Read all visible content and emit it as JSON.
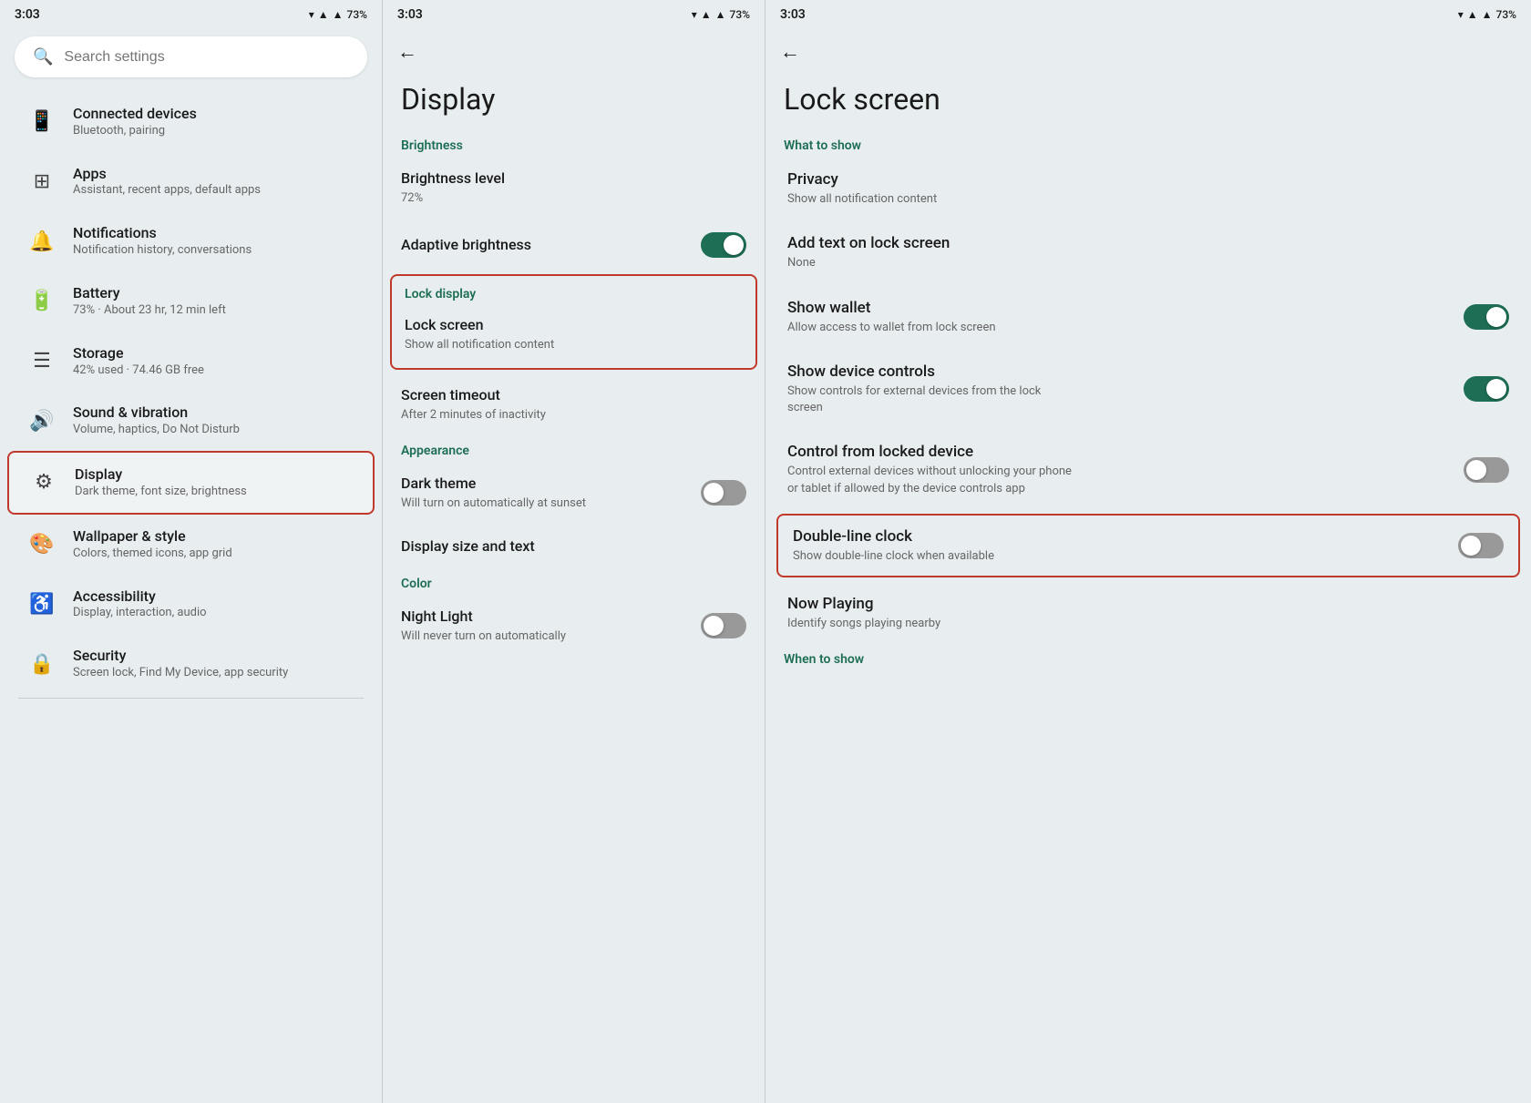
{
  "statusBar": {
    "time": "3:03",
    "battery": "73%"
  },
  "panel1": {
    "search": {
      "placeholder": "Search settings"
    },
    "items": [
      {
        "id": "connected-devices",
        "icon": "📱",
        "title": "Connected devices",
        "subtitle": "Bluetooth, pairing",
        "selected": false
      },
      {
        "id": "apps",
        "icon": "⊞",
        "title": "Apps",
        "subtitle": "Assistant, recent apps, default apps",
        "selected": false
      },
      {
        "id": "notifications",
        "icon": "🔔",
        "title": "Notifications",
        "subtitle": "Notification history, conversations",
        "selected": false
      },
      {
        "id": "battery",
        "icon": "🔋",
        "title": "Battery",
        "subtitle": "73% · About 23 hr, 12 min left",
        "selected": false
      },
      {
        "id": "storage",
        "icon": "☰",
        "title": "Storage",
        "subtitle": "42% used · 74.46 GB free",
        "selected": false
      },
      {
        "id": "sound-vibration",
        "icon": "🔊",
        "title": "Sound & vibration",
        "subtitle": "Volume, haptics, Do Not Disturb",
        "selected": false
      },
      {
        "id": "display",
        "icon": "⚙",
        "title": "Display",
        "subtitle": "Dark theme, font size, brightness",
        "selected": true
      },
      {
        "id": "wallpaper",
        "icon": "🎨",
        "title": "Wallpaper & style",
        "subtitle": "Colors, themed icons, app grid",
        "selected": false
      },
      {
        "id": "accessibility",
        "icon": "♿",
        "title": "Accessibility",
        "subtitle": "Display, interaction, audio",
        "selected": false
      },
      {
        "id": "security",
        "icon": "🔒",
        "title": "Security",
        "subtitle": "Screen lock, Find My Device, app security",
        "selected": false
      }
    ]
  },
  "panel2": {
    "backLabel": "←",
    "title": "Display",
    "sections": [
      {
        "label": "Brightness",
        "items": [
          {
            "id": "brightness-level",
            "title": "Brightness level",
            "subtitle": "72%",
            "hasToggle": false,
            "highlighted": false
          },
          {
            "id": "adaptive-brightness",
            "title": "Adaptive brightness",
            "subtitle": "",
            "hasToggle": true,
            "toggleOn": true,
            "highlighted": false
          }
        ]
      },
      {
        "label": "Lock display",
        "isHighlighted": true,
        "items": [
          {
            "id": "lock-screen",
            "title": "Lock screen",
            "subtitle": "Show all notification content",
            "hasToggle": false,
            "highlighted": true
          }
        ]
      },
      {
        "label": "",
        "items": [
          {
            "id": "screen-timeout",
            "title": "Screen timeout",
            "subtitle": "After 2 minutes of inactivity",
            "hasToggle": false,
            "highlighted": false
          }
        ]
      },
      {
        "label": "Appearance",
        "items": [
          {
            "id": "dark-theme",
            "title": "Dark theme",
            "subtitle": "Will turn on automatically at sunset",
            "hasToggle": true,
            "toggleOn": false,
            "highlighted": false
          },
          {
            "id": "display-size-text",
            "title": "Display size and text",
            "subtitle": "",
            "hasToggle": false,
            "highlighted": false
          }
        ]
      },
      {
        "label": "Color",
        "items": [
          {
            "id": "night-light",
            "title": "Night Light",
            "subtitle": "Will never turn on automatically",
            "hasToggle": true,
            "toggleOn": false,
            "highlighted": false
          }
        ]
      }
    ]
  },
  "panel3": {
    "backLabel": "←",
    "title": "Lock screen",
    "whatToShowLabel": "What to show",
    "whenToShowLabel": "When to show",
    "items": [
      {
        "id": "privacy",
        "title": "Privacy",
        "subtitle": "Show all notification content",
        "hasToggle": false,
        "highlighted": false
      },
      {
        "id": "add-text-lock-screen",
        "title": "Add text on lock screen",
        "subtitle": "None",
        "hasToggle": false,
        "highlighted": false
      },
      {
        "id": "show-wallet",
        "title": "Show wallet",
        "subtitle": "Allow access to wallet from lock screen",
        "hasToggle": true,
        "toggleOn": true,
        "highlighted": false
      },
      {
        "id": "show-device-controls",
        "title": "Show device controls",
        "subtitle": "Show controls for external devices from the lock screen",
        "hasToggle": true,
        "toggleOn": true,
        "highlighted": false
      },
      {
        "id": "control-from-locked",
        "title": "Control from locked device",
        "subtitle": "Control external devices without unlocking your phone or tablet if allowed by the device controls app",
        "hasToggle": true,
        "toggleOn": false,
        "highlighted": false
      },
      {
        "id": "double-line-clock",
        "title": "Double-line clock",
        "subtitle": "Show double-line clock when available",
        "hasToggle": true,
        "toggleOn": false,
        "highlighted": true
      },
      {
        "id": "now-playing",
        "title": "Now Playing",
        "subtitle": "Identify songs playing nearby",
        "hasToggle": false,
        "highlighted": false
      }
    ]
  }
}
